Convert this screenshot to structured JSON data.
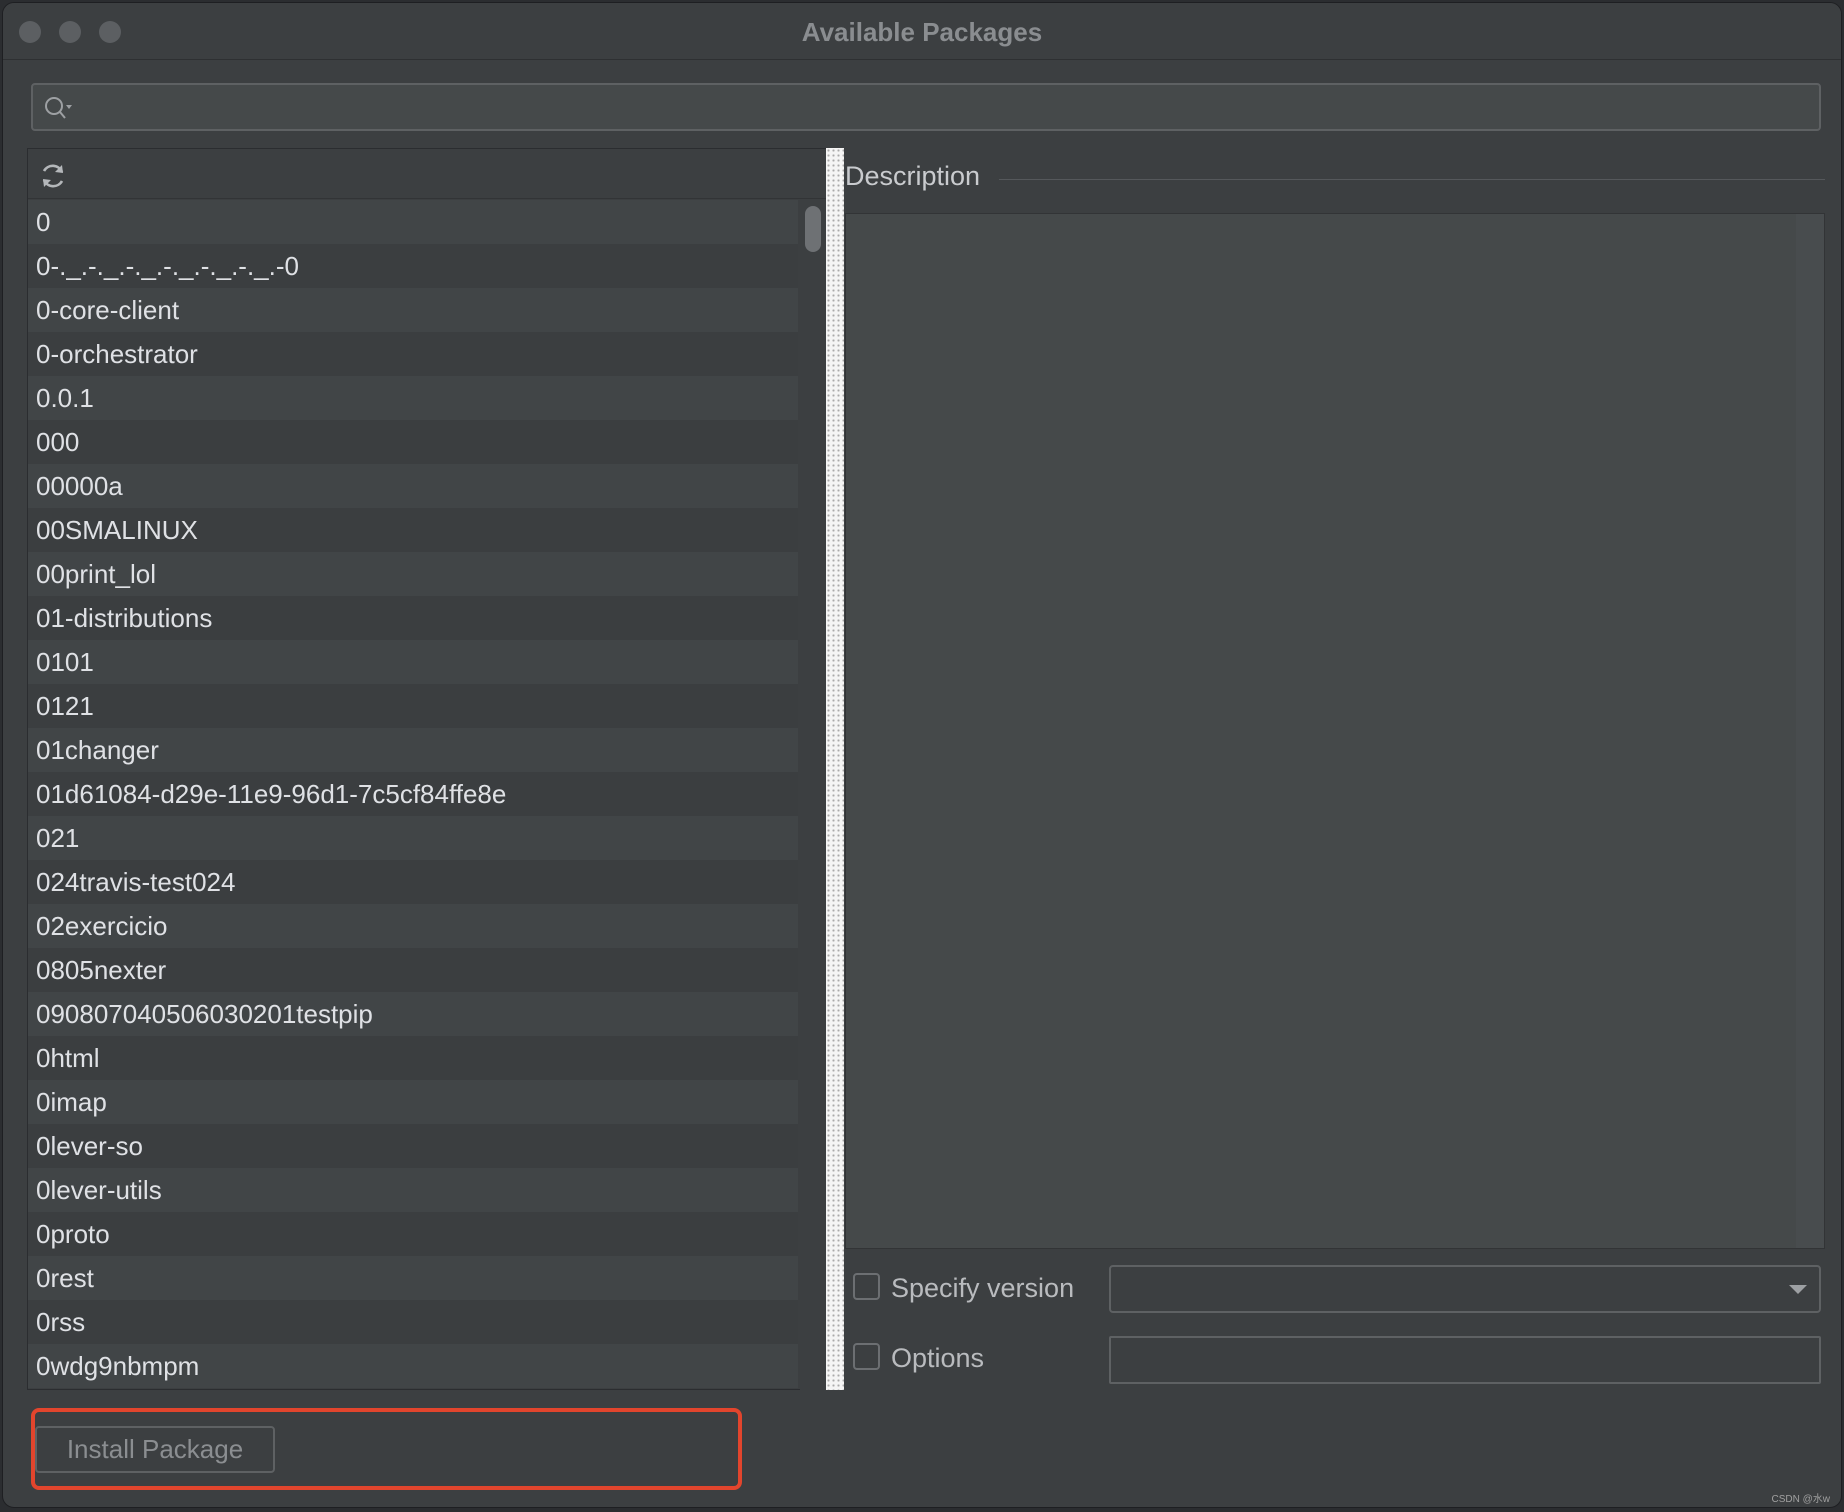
{
  "window": {
    "title": "Available Packages"
  },
  "search": {
    "value": "",
    "placeholder": ""
  },
  "packages": [
    "0",
    "0-._.-._.-._.-._.-._.-._.-0",
    "0-core-client",
    "0-orchestrator",
    "0.0.1",
    "000",
    "00000a",
    "00SMALINUX",
    "00print_lol",
    "01-distributions",
    "0101",
    "0121",
    "01changer",
    "01d61084-d29e-11e9-96d1-7c5cf84ffe8e",
    "021",
    "024travis-test024",
    "02exercicio",
    "0805nexter",
    "090807040506030201testpip",
    "0html",
    "0imap",
    "0lever-so",
    "0lever-utils",
    "0proto",
    "0rest",
    "0rss",
    "0wdg9nbmpm"
  ],
  "description": {
    "header": "Description",
    "text": ""
  },
  "options": {
    "specify_version_label": "Specify version",
    "specify_version_checked": false,
    "version_value": "",
    "options_label": "Options",
    "options_checked": false,
    "options_value": ""
  },
  "actions": {
    "install_label": "Install Package"
  },
  "watermark": "CSDN @水w",
  "colors": {
    "highlight": "#e2452d",
    "background": "#3c3f41"
  }
}
